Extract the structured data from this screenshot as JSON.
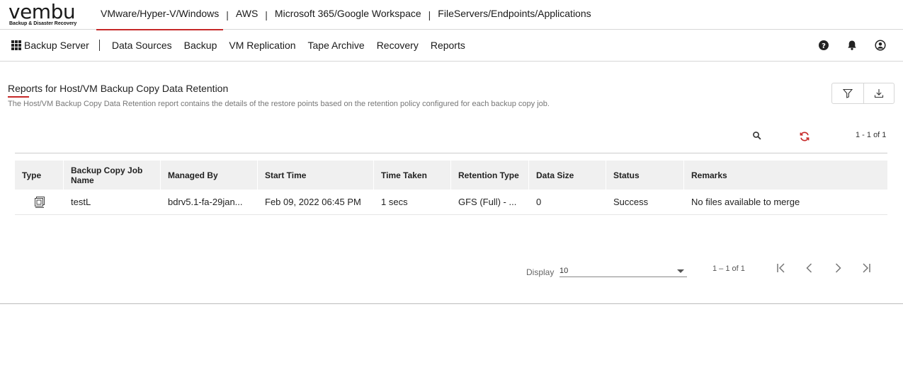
{
  "logo": {
    "word": "vembu",
    "tagline": "Backup & Disaster Recovery"
  },
  "products": [
    {
      "label": "VMware/Hyper-V/Windows",
      "active": true
    },
    {
      "label": "AWS"
    },
    {
      "label": "Microsoft 365/Google Workspace"
    },
    {
      "label": "FileServers/Endpoints/Applications"
    }
  ],
  "separator": "|",
  "nav": {
    "server_label": "Backup Server",
    "items": [
      "Data Sources",
      "Backup",
      "VM Replication",
      "Tape Archive",
      "Recovery",
      "Reports"
    ]
  },
  "report": {
    "title": "Reports for Host/VM Backup Copy Data Retention",
    "description": "The Host/VM Backup Copy Data Retention report contains the details of the restore points based on the retention policy configured for each backup copy job."
  },
  "toolbar": {
    "count": "1 - 1 of 1"
  },
  "table": {
    "columns": [
      "Type",
      "Backup Copy Job Name",
      "Managed By",
      "Start Time",
      "Time Taken",
      "Retention Type",
      "Data Size",
      "Status",
      "Remarks"
    ],
    "rows": [
      {
        "type_icon": "vm-copy-icon",
        "job": "testL",
        "managed_by": "bdrv5.1-fa-29jan...",
        "start": "Feb 09, 2022 06:45 PM",
        "time_taken": "1 secs",
        "retention": "GFS (Full) - ...",
        "size": "0",
        "status": "Success",
        "remarks": "No files available to merge"
      }
    ]
  },
  "pagination": {
    "display_label": "Display",
    "page_size": "10",
    "count": "1 – 1 of 1"
  },
  "colors": {
    "accent": "#c62828",
    "header_bg": "#f0f0f0"
  }
}
